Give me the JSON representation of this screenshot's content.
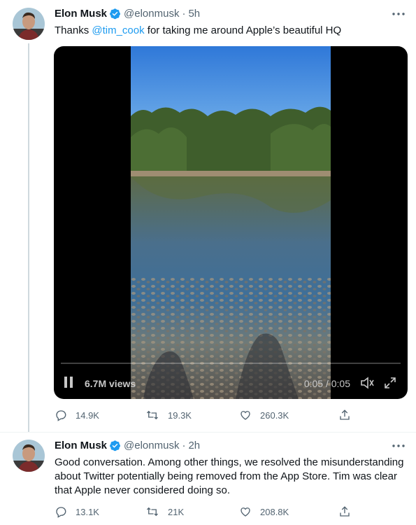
{
  "tweets": [
    {
      "name": "Elon Musk",
      "handle": "@elonmusk",
      "time": "5h",
      "text_prefix": "Thanks ",
      "mention": "@tim_cook",
      "text_suffix": " for taking me around Apple’s beautiful HQ",
      "video": {
        "views": "6.7M views",
        "time": "0:05 / 0:05",
        "progress": 1.0
      },
      "actions": {
        "replies": "14.9K",
        "retweets": "19.3K",
        "likes": "260.3K"
      }
    },
    {
      "name": "Elon Musk",
      "handle": "@elonmusk",
      "time": "2h",
      "text_line1": "Good conversation. Among other things, we resolved the misunderstanding",
      "text_line2": "about Twitter potentially being removed from the App Store. Tim was clear",
      "text_line3": "that Apple never considered doing so.",
      "actions": {
        "replies": "13.1K",
        "retweets": "21K",
        "likes": "208.8K"
      }
    }
  ],
  "icons": {
    "verified": "verified-badge-icon",
    "more": "more-icon",
    "reply": "reply-icon",
    "retweet": "retweet-icon",
    "like": "like-icon",
    "share": "share-icon"
  },
  "colors": {
    "accent": "#1d9bf0",
    "secondary": "#536471"
  }
}
